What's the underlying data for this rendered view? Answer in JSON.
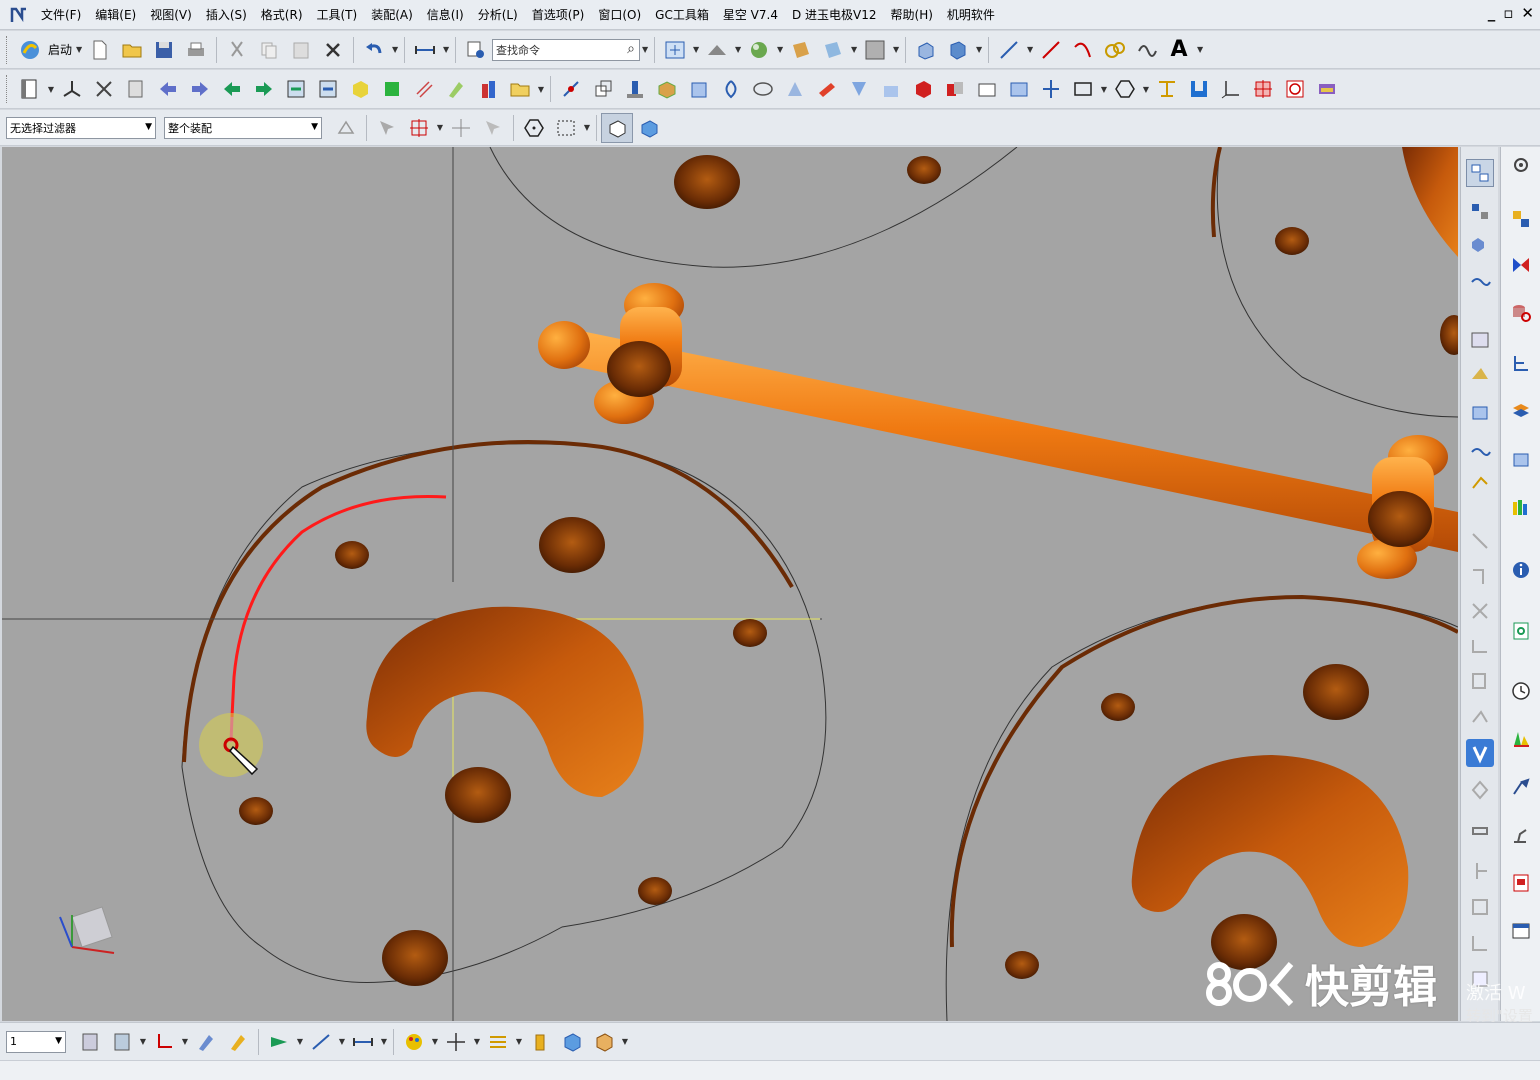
{
  "menubar": {
    "items": [
      "文件(F)",
      "编辑(E)",
      "视图(V)",
      "插入(S)",
      "格式(R)",
      "工具(T)",
      "装配(A)",
      "信息(I)",
      "分析(L)",
      "首选项(P)",
      "窗口(O)",
      "GC工具箱",
      "星空 V7.4",
      "D 进玉电极V12",
      "帮助(H)",
      "机明软件"
    ],
    "window_controls": [
      "_",
      "▫",
      "✕"
    ]
  },
  "toolbar1": {
    "start_label": "启动",
    "search_placeholder": "查找命令",
    "text_tool_label": "A"
  },
  "toolbar3": {
    "filter_value": "无选择过滤器",
    "assembly_value": "整个装配"
  },
  "bottombar": {
    "layer_value": "1"
  },
  "watermark": {
    "brand": "快剪辑",
    "activate_line1": "激活 W",
    "activate_line2": "转到\"设置"
  },
  "colors": {
    "viewport_bg": "#a4a4a4",
    "copper": "#e07010",
    "copper_dark": "#7a2e05",
    "sketch_curve": "#ff1a1a"
  }
}
